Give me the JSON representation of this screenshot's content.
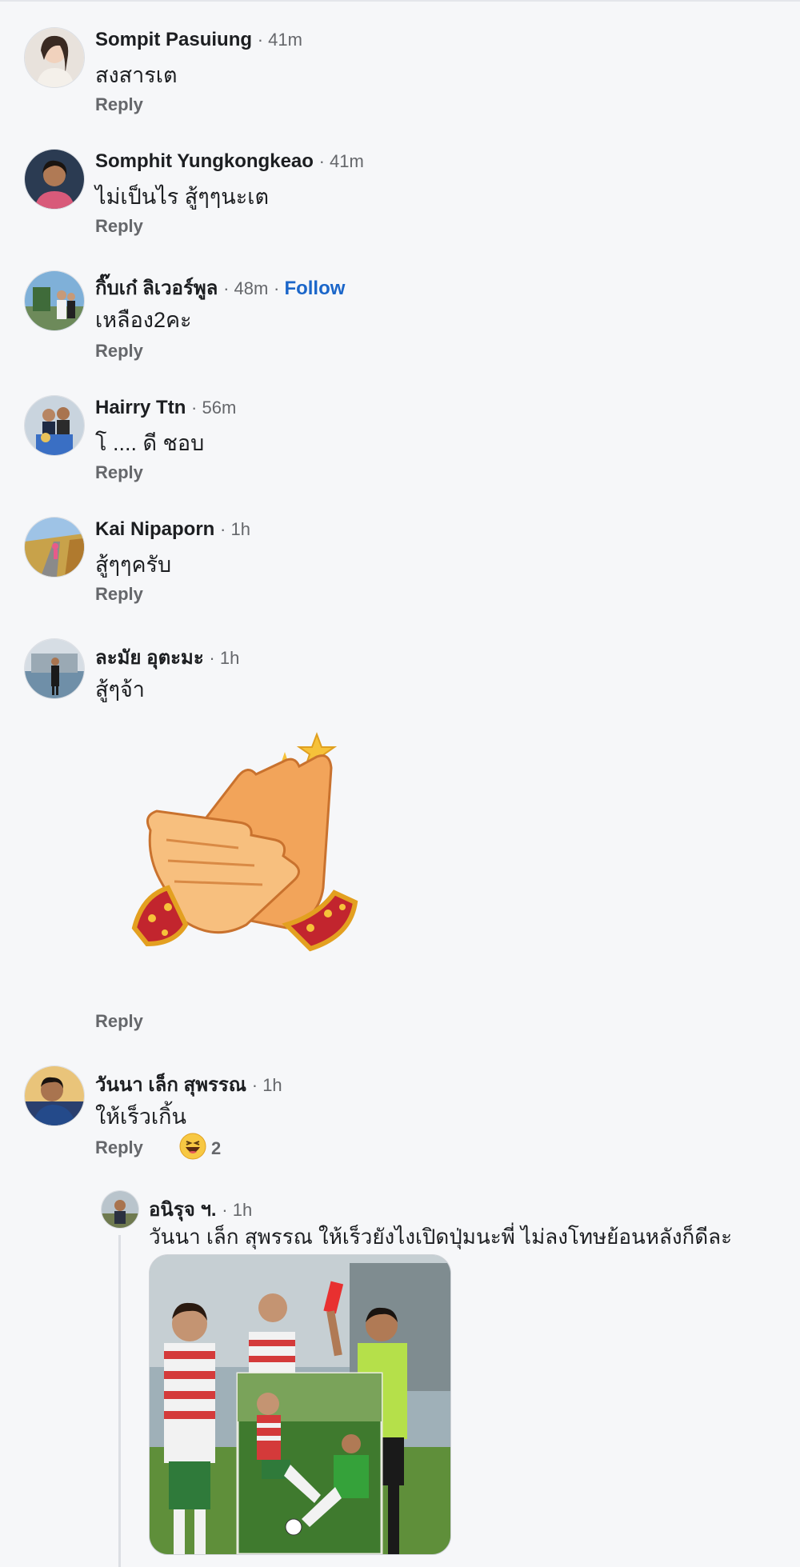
{
  "comments": [
    {
      "name": "Sompit Pasuiung",
      "time": "41m",
      "text": "สงสารเต",
      "reply": "Reply"
    },
    {
      "name": "Somphit Yungkongkeao",
      "time": "41m",
      "text": "ไม่เป็นไร สู้ๆๆนะเต",
      "reply": "Reply"
    },
    {
      "name": "กิ๊บเก๋ ลิเวอร์พูล",
      "time": "48m",
      "follow": "Follow",
      "text": "เหลือง2คะ",
      "reply": "Reply"
    },
    {
      "name": "Hairry Ttn",
      "time": "56m",
      "text": "โ .... ดี  ชอบ",
      "reply": "Reply"
    },
    {
      "name": "Kai Nipaporn",
      "time": "1h",
      "text": "สู้ๆๆครับ",
      "reply": "Reply"
    },
    {
      "name": "ละมัย อุตะมะ",
      "time": "1h",
      "text": "สู้ๆจ้า",
      "reply": "Reply",
      "sticker": "clapping-hands-sticker"
    },
    {
      "name": "วันนา เล็ก สุพรรณ",
      "time": "1h",
      "text": "ให้เร็วเกิ้น",
      "reply": "Reply",
      "reaction": {
        "icon": "haha-emoji-icon",
        "count": "2"
      }
    }
  ],
  "nested_reply": {
    "name": "อนิรุจ ฯ.",
    "time": "1h",
    "text": "วันนา เล็ก สุพรรณ ให้เร็วยังไงเปิดปุ่มนะพี่ ไม่ลงโทษย้อนหลังก็ดีละ",
    "photo": "football-red-card-photo"
  },
  "colors": {
    "background": "#f6f7f9",
    "name": "#1c1e21",
    "muted": "#65676b",
    "follow": "#1b66c9"
  }
}
